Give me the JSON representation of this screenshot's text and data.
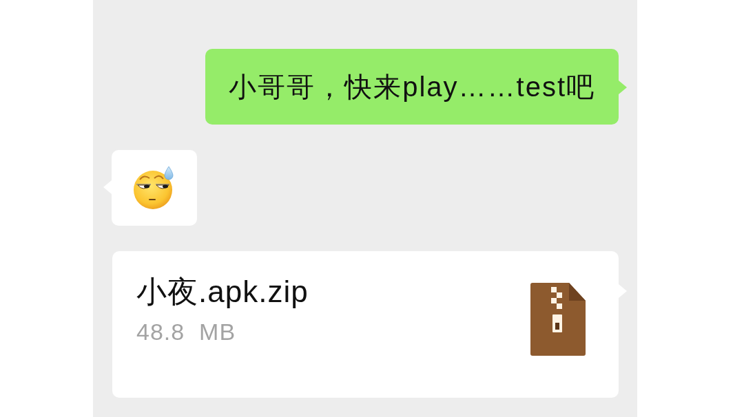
{
  "messages": [
    {
      "kind": "text",
      "outgoing": true,
      "text": "小哥哥，快来play……test吧"
    },
    {
      "kind": "sticker",
      "outgoing": false
    },
    {
      "kind": "file",
      "outgoing": true,
      "name": "小夜.apk.zip",
      "size": "48.8  MB"
    }
  ]
}
